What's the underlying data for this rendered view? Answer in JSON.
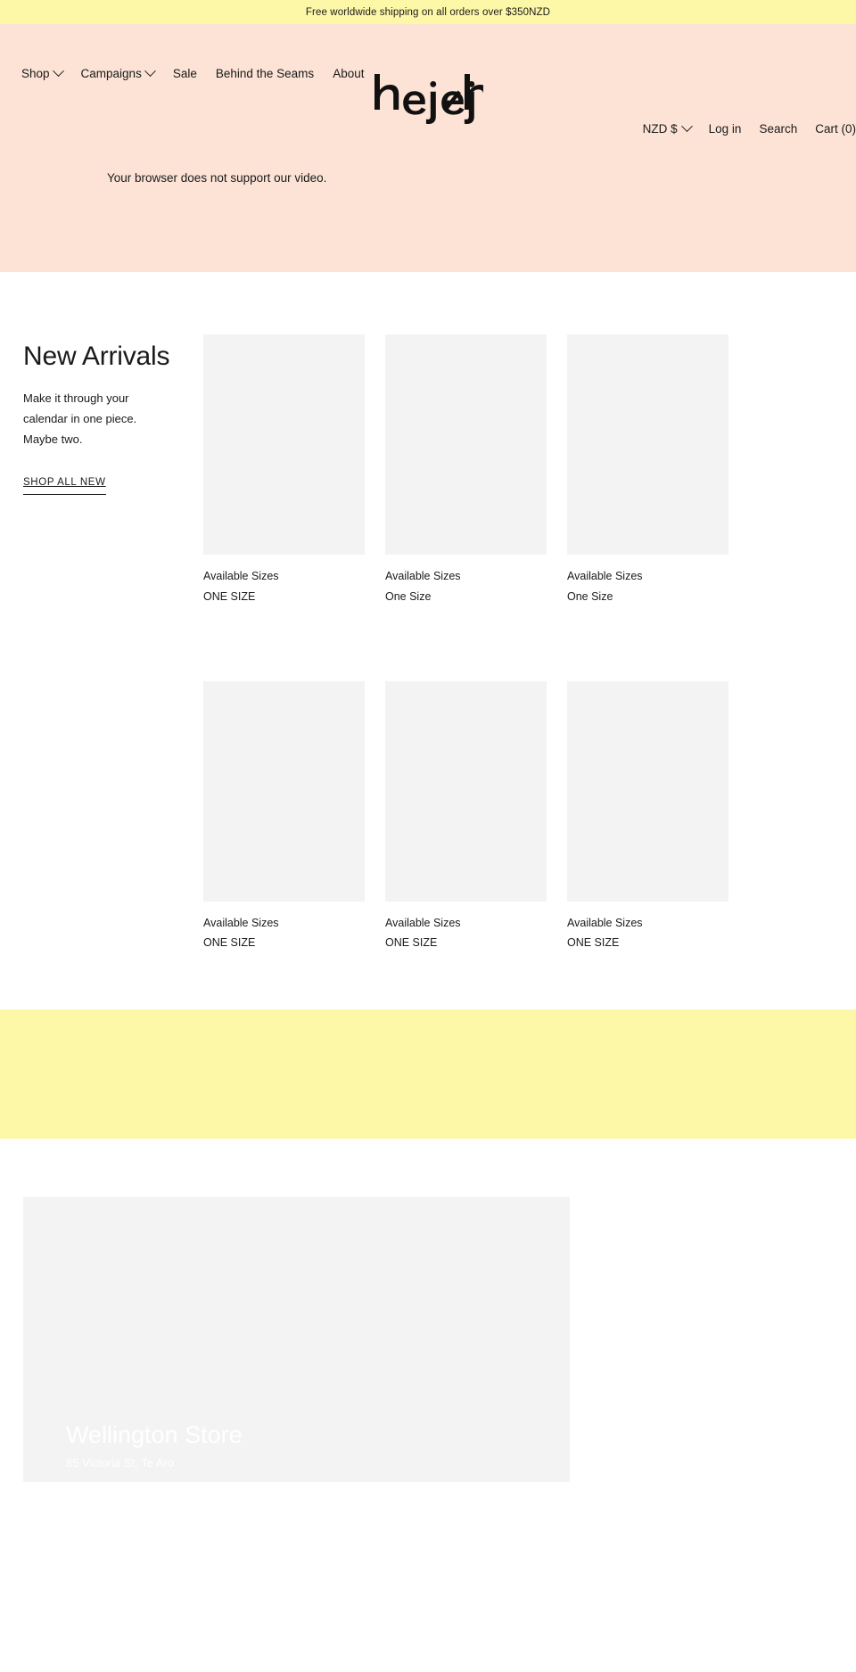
{
  "announcement": {
    "text": "Free worldwide shipping on all orders over $350NZD",
    "background": "#fdf8a8"
  },
  "header": {
    "background": "#fce3d5",
    "logo_text": "hej ⁄ hej",
    "nav": [
      {
        "label": "Shop",
        "has_dropdown": true
      },
      {
        "label": "Campaigns",
        "has_dropdown": true
      },
      {
        "label": "Sale",
        "has_dropdown": false
      },
      {
        "label": "Behind the Seams",
        "has_dropdown": false
      },
      {
        "label": "About",
        "has_dropdown": false
      }
    ],
    "utility": [
      {
        "label": "NZD $",
        "has_dropdown": true,
        "name": "currency-selector"
      },
      {
        "label": "Log in",
        "has_dropdown": false,
        "name": "login-link"
      },
      {
        "label": "Search",
        "has_dropdown": false,
        "name": "search-link"
      },
      {
        "label": "Cart (0)",
        "has_dropdown": false,
        "name": "cart-link"
      }
    ],
    "video_fallback": "Your browser does not support our video."
  },
  "new_arrivals": {
    "title": "New Arrivals",
    "subtitle": "Make it through your calendar in one piece. Maybe two.",
    "cta": "SHOP ALL NEW",
    "products": [
      {
        "sizes_label": "Available Sizes",
        "sizes_value": "ONE SIZE"
      },
      {
        "sizes_label": "Available Sizes",
        "sizes_value": "One Size"
      },
      {
        "sizes_label": "Available Sizes",
        "sizes_value": "One Size"
      },
      {
        "sizes_label": "Available Sizes",
        "sizes_value": "ONE SIZE"
      },
      {
        "sizes_label": "Available Sizes",
        "sizes_value": "ONE SIZE"
      },
      {
        "sizes_label": "Available Sizes",
        "sizes_value": "ONE SIZE"
      }
    ]
  },
  "band": {
    "background": "#fdf8a8"
  },
  "stores": {
    "items": [
      {
        "name": "Wellington Store",
        "address": "85 Victoria St, Te Aro"
      }
    ]
  }
}
